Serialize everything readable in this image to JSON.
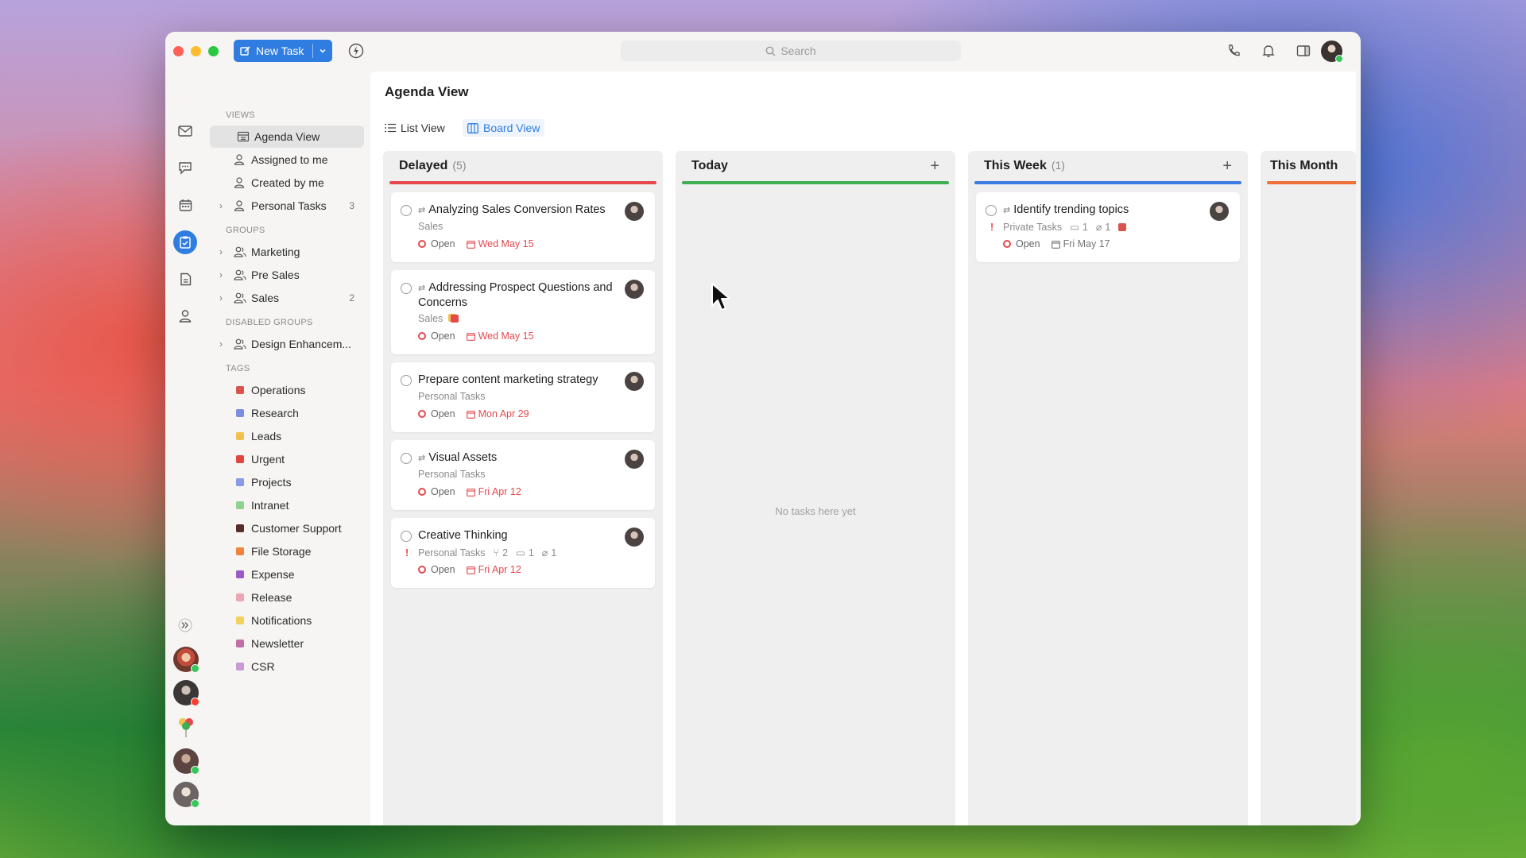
{
  "toolbar": {
    "new_task_label": "New Task",
    "search_placeholder": "Search"
  },
  "sidebar": {
    "views_title": "VIEWS",
    "views": [
      {
        "label": "Agenda View",
        "count": ""
      },
      {
        "label": "Assigned to me",
        "count": ""
      },
      {
        "label": "Created by me",
        "count": ""
      },
      {
        "label": "Personal Tasks",
        "count": "3"
      }
    ],
    "groups_title": "GROUPS",
    "groups": [
      {
        "label": "Marketing",
        "count": ""
      },
      {
        "label": "Pre Sales",
        "count": ""
      },
      {
        "label": "Sales",
        "count": "2"
      }
    ],
    "disabled_groups_title": "DISABLED GROUPS",
    "disabled_groups": [
      {
        "label": "Design Enhancem...",
        "count": ""
      }
    ],
    "tags_title": "TAGS",
    "tags": [
      {
        "label": "Operations",
        "color": "#d9534f"
      },
      {
        "label": "Research",
        "color": "#7b8fe0"
      },
      {
        "label": "Leads",
        "color": "#f2c14e"
      },
      {
        "label": "Urgent",
        "color": "#e0453e"
      },
      {
        "label": "Projects",
        "color": "#8a9ae6"
      },
      {
        "label": "Intranet",
        "color": "#8fd18f"
      },
      {
        "label": "Customer Support",
        "color": "#5a2b2b"
      },
      {
        "label": "File Storage",
        "color": "#f0843a"
      },
      {
        "label": "Expense",
        "color": "#9a5bc7"
      },
      {
        "label": "Release",
        "color": "#f0a4b4"
      },
      {
        "label": "Notifications",
        "color": "#f2d25e"
      },
      {
        "label": "Newsletter",
        "color": "#c06fa6"
      },
      {
        "label": "CSR",
        "color": "#c89ad6"
      }
    ]
  },
  "main": {
    "title": "Agenda View",
    "tabs": [
      {
        "label": "List View"
      },
      {
        "label": "Board View"
      }
    ],
    "columns": [
      {
        "title": "Delayed",
        "count": "(5)",
        "color": "#e5484d"
      },
      {
        "title": "Today",
        "count": "",
        "color": "#3fae55",
        "empty_text": "No tasks here yet"
      },
      {
        "title": "This Week",
        "count": "(1)",
        "color": "#3b7de0"
      },
      {
        "title": "This Month",
        "count": "",
        "color": "#f0703a"
      }
    ],
    "cards": [
      {
        "title": "Analyzing Sales Conversion Rates",
        "group": "Sales",
        "status": "Open",
        "due": "Wed May 15"
      },
      {
        "title": "Addressing Prospect Questions and Concerns",
        "group": "Sales",
        "status": "Open",
        "due": "Wed May 15"
      },
      {
        "title": "Prepare content marketing strategy",
        "group": "Personal Tasks",
        "status": "Open",
        "due": "Mon Apr 29"
      },
      {
        "title": "Visual Assets",
        "group": "Personal Tasks",
        "status": "Open",
        "due": "Fri Apr 12"
      },
      {
        "title": "Creative Thinking",
        "group": "Personal Tasks",
        "subtasks": "2",
        "comments": "1",
        "attachments": "1",
        "status": "Open",
        "due": "Fri Apr 12"
      },
      {
        "title": "Identify trending topics",
        "group": "Private Tasks",
        "comments": "1",
        "attachments": "1",
        "status": "Open",
        "due": "Fri May 17"
      }
    ]
  }
}
